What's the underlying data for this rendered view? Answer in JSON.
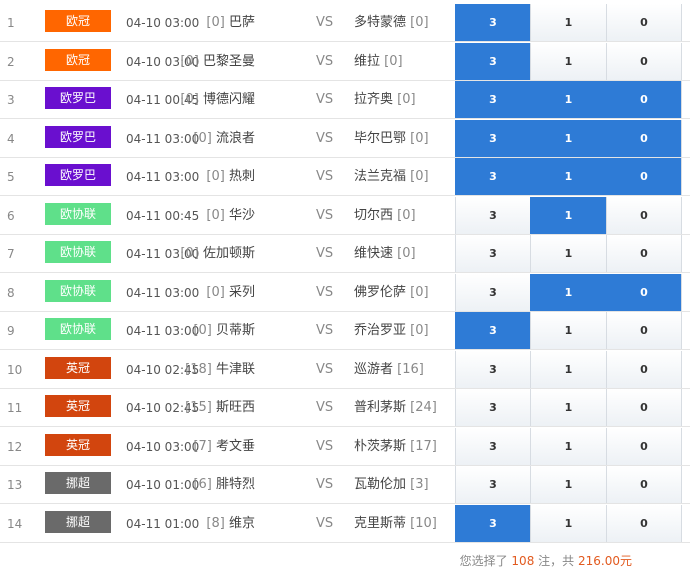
{
  "colors": {
    "ucl": "#ff6600",
    "uel": "#6a0fcf",
    "uecl": "#5fe08a",
    "epl": "#d2450e",
    "nor": "#6a6a6a",
    "selected": "#2e7bd6"
  },
  "matches": [
    {
      "no": "1",
      "league": "欧冠",
      "color": "#ff6600",
      "time": "04-10 03:00",
      "home_rank": "[0]",
      "home": "巴萨",
      "vs": "VS",
      "away": "多特蒙德",
      "away_rank": "[0]",
      "opts": [
        "3",
        "1",
        "0"
      ],
      "sel": [
        true,
        false,
        false
      ]
    },
    {
      "no": "2",
      "league": "欧冠",
      "color": "#ff6600",
      "time": "04-10 03:00",
      "home_rank": "[0]",
      "home": "巴黎圣曼",
      "vs": "VS",
      "away": "维拉",
      "away_rank": "[0]",
      "opts": [
        "3",
        "1",
        "0"
      ],
      "sel": [
        true,
        false,
        false
      ]
    },
    {
      "no": "3",
      "league": "欧罗巴",
      "color": "#6a0fcf",
      "time": "04-11 00:45",
      "home_rank": "[0]",
      "home": "博德闪耀",
      "vs": "VS",
      "away": "拉齐奥",
      "away_rank": "[0]",
      "opts": [
        "3",
        "1",
        "0"
      ],
      "sel": [
        true,
        true,
        true
      ]
    },
    {
      "no": "4",
      "league": "欧罗巴",
      "color": "#6a0fcf",
      "time": "04-11 03:00",
      "home_rank": "[0]",
      "home": "流浪者",
      "vs": "VS",
      "away": "毕尔巴鄂",
      "away_rank": "[0]",
      "opts": [
        "3",
        "1",
        "0"
      ],
      "sel": [
        true,
        true,
        true
      ]
    },
    {
      "no": "5",
      "league": "欧罗巴",
      "color": "#6a0fcf",
      "time": "04-11 03:00",
      "home_rank": "[0]",
      "home": "热刺",
      "vs": "VS",
      "away": "法兰克福",
      "away_rank": "[0]",
      "opts": [
        "3",
        "1",
        "0"
      ],
      "sel": [
        true,
        true,
        true
      ]
    },
    {
      "no": "6",
      "league": "欧协联",
      "color": "#5fe08a",
      "time": "04-11 00:45",
      "home_rank": "[0]",
      "home": "华沙",
      "vs": "VS",
      "away": "切尔西",
      "away_rank": "[0]",
      "opts": [
        "3",
        "1",
        "0"
      ],
      "sel": [
        false,
        true,
        false
      ]
    },
    {
      "no": "7",
      "league": "欧协联",
      "color": "#5fe08a",
      "time": "04-11 03:00",
      "home_rank": "[0]",
      "home": "佐加顿斯",
      "vs": "VS",
      "away": "维快速",
      "away_rank": "[0]",
      "opts": [
        "3",
        "1",
        "0"
      ],
      "sel": [
        false,
        false,
        false
      ]
    },
    {
      "no": "8",
      "league": "欧协联",
      "color": "#5fe08a",
      "time": "04-11 03:00",
      "home_rank": "[0]",
      "home": "采列",
      "vs": "VS",
      "away": "佛罗伦萨",
      "away_rank": "[0]",
      "opts": [
        "3",
        "1",
        "0"
      ],
      "sel": [
        false,
        true,
        true
      ]
    },
    {
      "no": "9",
      "league": "欧协联",
      "color": "#5fe08a",
      "time": "04-11 03:00",
      "home_rank": "[0]",
      "home": "贝蒂斯",
      "vs": "VS",
      "away": "乔治罗亚",
      "away_rank": "[0]",
      "opts": [
        "3",
        "1",
        "0"
      ],
      "sel": [
        true,
        false,
        false
      ]
    },
    {
      "no": "10",
      "league": "英冠",
      "color": "#d2450e",
      "time": "04-10 02:45",
      "home_rank": "[18]",
      "home": "牛津联",
      "vs": "VS",
      "away": "巡游者",
      "away_rank": "[16]",
      "opts": [
        "3",
        "1",
        "0"
      ],
      "sel": [
        false,
        false,
        false
      ]
    },
    {
      "no": "11",
      "league": "英冠",
      "color": "#d2450e",
      "time": "04-10 02:45",
      "home_rank": "[15]",
      "home": "斯旺西",
      "vs": "VS",
      "away": "普利茅斯",
      "away_rank": "[24]",
      "opts": [
        "3",
        "1",
        "0"
      ],
      "sel": [
        false,
        false,
        false
      ]
    },
    {
      "no": "12",
      "league": "英冠",
      "color": "#d2450e",
      "time": "04-10 03:00",
      "home_rank": "[7]",
      "home": "考文垂",
      "vs": "VS",
      "away": "朴茨茅斯",
      "away_rank": "[17]",
      "opts": [
        "3",
        "1",
        "0"
      ],
      "sel": [
        false,
        false,
        false
      ]
    },
    {
      "no": "13",
      "league": "挪超",
      "color": "#6a6a6a",
      "time": "04-10 01:00",
      "home_rank": "[6]",
      "home": "腓特烈",
      "vs": "VS",
      "away": "瓦勒伦加",
      "away_rank": "[3]",
      "opts": [
        "3",
        "1",
        "0"
      ],
      "sel": [
        false,
        false,
        false
      ]
    },
    {
      "no": "14",
      "league": "挪超",
      "color": "#6a6a6a",
      "time": "04-11 01:00",
      "home_rank": "[8]",
      "home": "维京",
      "vs": "VS",
      "away": "克里斯蒂",
      "away_rank": "[10]",
      "opts": [
        "3",
        "1",
        "0"
      ],
      "sel": [
        true,
        false,
        false
      ]
    }
  ],
  "summary": {
    "prefix": "您选择了",
    "count": "108",
    "mid": "注，共",
    "amount": "216.00元"
  }
}
